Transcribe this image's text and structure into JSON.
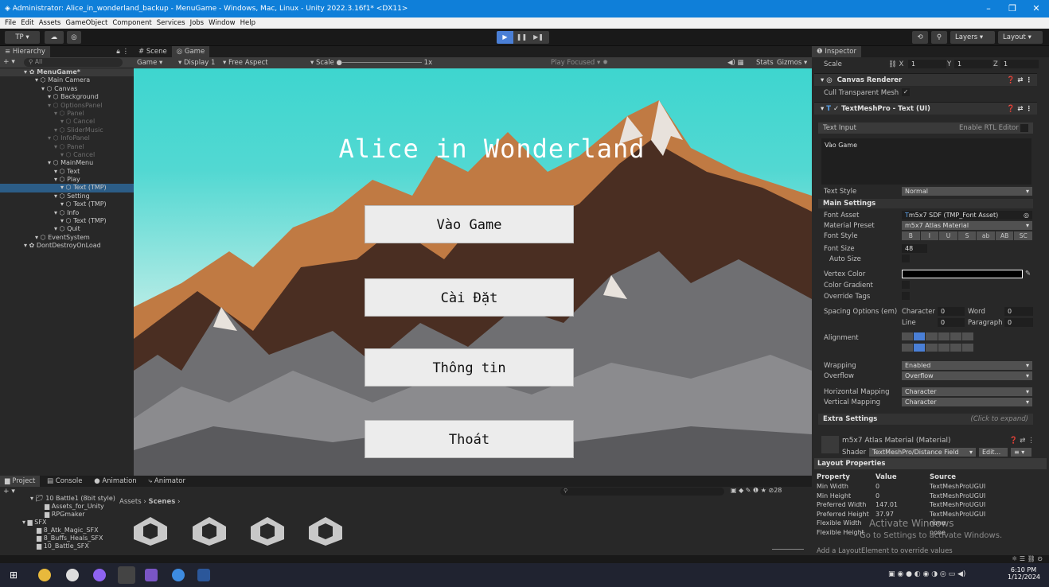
{
  "window": {
    "title": "Administrator: Alice_in_wonderland_backup - MenuGame - Windows, Mac, Linux - Unity 2022.3.16f1* <DX11>"
  },
  "menu": [
    "File",
    "Edit",
    "Assets",
    "GameObject",
    "Component",
    "Services",
    "Jobs",
    "Window",
    "Help"
  ],
  "toolbar": {
    "account": "TP ▾",
    "layers": "Layers",
    "layout": "Layout"
  },
  "hierarchy": {
    "tab": "Hierarchy",
    "search": "All",
    "items": [
      {
        "label": "MenuGame*",
        "depth": 0,
        "state": "scene"
      },
      {
        "label": "Main Camera",
        "depth": 1,
        "state": "normal"
      },
      {
        "label": "Canvas",
        "depth": 2,
        "state": "normal"
      },
      {
        "label": "Background",
        "depth": 3,
        "state": "normal"
      },
      {
        "label": "OptionsPanel",
        "depth": 3,
        "state": "dim"
      },
      {
        "label": "Panel",
        "depth": 4,
        "state": "dim"
      },
      {
        "label": "Cancel",
        "depth": 5,
        "state": "dim"
      },
      {
        "label": "SliderMusic",
        "depth": 4,
        "state": "dim"
      },
      {
        "label": "InfoPanel",
        "depth": 3,
        "state": "dim"
      },
      {
        "label": "Panel",
        "depth": 4,
        "state": "dim"
      },
      {
        "label": "Cancel",
        "depth": 5,
        "state": "dim"
      },
      {
        "label": "MainMenu",
        "depth": 3,
        "state": "normal"
      },
      {
        "label": "Text",
        "depth": 4,
        "state": "normal"
      },
      {
        "label": "Play",
        "depth": 4,
        "state": "normal"
      },
      {
        "label": "Text (TMP)",
        "depth": 5,
        "state": "sel"
      },
      {
        "label": "Setting",
        "depth": 4,
        "state": "normal"
      },
      {
        "label": "Text (TMP)",
        "depth": 5,
        "state": "normal"
      },
      {
        "label": "Info",
        "depth": 4,
        "state": "normal"
      },
      {
        "label": "Text (TMP)",
        "depth": 5,
        "state": "normal"
      },
      {
        "label": "Quit",
        "depth": 4,
        "state": "normal"
      },
      {
        "label": "EventSystem",
        "depth": 1,
        "state": "normal"
      },
      {
        "label": "DontDestroyOnLoad",
        "depth": 0,
        "state": "scene2"
      }
    ]
  },
  "scene_tabs": [
    "Scene",
    "Game"
  ],
  "gamebar": {
    "mode": "Game",
    "display": "Display 1",
    "aspect": "Free Aspect",
    "scale_label": "Scale",
    "scale_value": "1x",
    "play_focused": "Play Focused",
    "stats": "Stats",
    "gizmos": "Gizmos"
  },
  "game": {
    "title": "Alice in Wonderland",
    "buttons": [
      "Vào Game",
      "Cài Đặt",
      "Thông tin",
      "Thoát"
    ]
  },
  "inspector": {
    "tab": "Inspector",
    "scale": {
      "label": "Scale",
      "x": "1",
      "y": "1",
      "z": "1"
    },
    "canvas_renderer": "Canvas Renderer",
    "cull_label": "Cull Transparent Mesh",
    "tmp_header": "TextMeshPro - Text (UI)",
    "text_input_label": "Text Input",
    "rtl_label": "Enable RTL Editor",
    "text_value": "Vào Game",
    "text_style_label": "Text Style",
    "text_style_value": "Normal",
    "main_settings": "Main Settings",
    "font_asset_label": "Font Asset",
    "font_asset_value": "m5x7 SDF (TMP_Font Asset)",
    "material_preset_label": "Material Preset",
    "material_preset_value": "m5x7 Atlas Material",
    "font_style_label": "Font Style",
    "font_style_buttons": [
      "B",
      "I",
      "U",
      "S",
      "ab",
      "AB",
      "SC"
    ],
    "font_size_label": "Font Size",
    "font_size_value": "48",
    "auto_size_label": "Auto Size",
    "vertex_color_label": "Vertex Color",
    "color_gradient_label": "Color Gradient",
    "override_tags_label": "Override Tags",
    "spacing_label": "Spacing Options (em)",
    "spacing": {
      "character": "Character",
      "character_v": "0",
      "word": "Word",
      "word_v": "0",
      "line": "Line",
      "line_v": "0",
      "paragraph": "Paragraph",
      "paragraph_v": "0"
    },
    "alignment_label": "Alignment",
    "wrapping_label": "Wrapping",
    "wrapping_value": "Enabled",
    "overflow_label": "Overflow",
    "overflow_value": "Overflow",
    "hmap_label": "Horizontal Mapping",
    "hmap_value": "Character",
    "vmap_label": "Vertical Mapping",
    "vmap_value": "Character",
    "extra_settings": "Extra Settings",
    "click_expand": "(Click to expand)",
    "material_name": "m5x7 Atlas Material (Material)",
    "shader_label": "Shader",
    "shader_value": "TextMeshPro/Distance Field",
    "shader_edit": "Edit...",
    "layout_props": "Layout Properties",
    "layout_headers": [
      "Property",
      "Value",
      "Source"
    ],
    "layout_rows": [
      [
        "Min Width",
        "0",
        "TextMeshProUGUI"
      ],
      [
        "Min Height",
        "0",
        "TextMeshProUGUI"
      ],
      [
        "Preferred Width",
        "147.01",
        "TextMeshProUGUI"
      ],
      [
        "Preferred Height",
        "37.97",
        "TextMeshProUGUI"
      ],
      [
        "Flexible Width",
        "",
        "none"
      ],
      [
        "Flexible Height",
        "",
        "none"
      ]
    ],
    "footer_text": "Add a LayoutElement to override values"
  },
  "watermark": {
    "line1": "Activate Windows",
    "line2": "Go to Settings to activate Windows."
  },
  "project": {
    "tabs": [
      "Project",
      "Console",
      "Animation",
      "Animator"
    ],
    "tree": [
      "10 Battle1 (8bit style)",
      "Assets_for_Unity",
      "RPGmaker",
      "SFX",
      "8_Atk_Magic_SFX",
      "8_Buffs_Heals_SFX",
      "10_Battle_SFX"
    ],
    "breadcrumb": [
      "Assets",
      "Scenes"
    ],
    "count": "28"
  },
  "taskbar": {
    "time": "6:10 PM",
    "date": "1/12/2024"
  }
}
